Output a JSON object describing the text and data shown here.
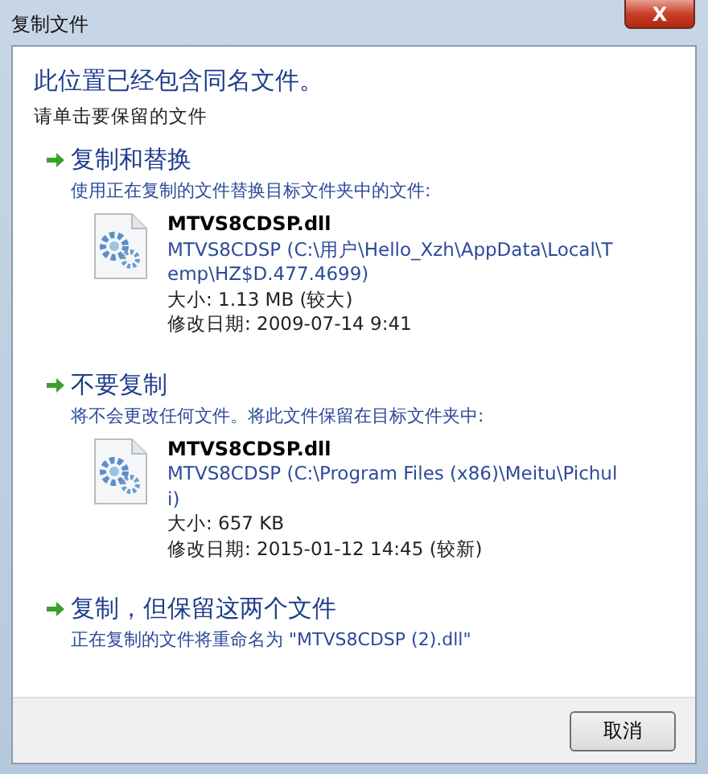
{
  "window": {
    "title": "复制文件",
    "close_label": "X"
  },
  "heading": "此位置已经包含同名文件。",
  "instruction": "请单击要保留的文件",
  "options": [
    {
      "title": "复制和替换",
      "description": "使用正在复制的文件替换目标文件夹中的文件:",
      "file": {
        "name": "MTVS8CDSP.dll",
        "location": "MTVS8CDSP (C:\\用户\\Hello_Xzh\\AppData\\Local\\Temp\\HZ$D.477.4699)",
        "size": "大小: 1.13 MB (较大)",
        "modified": "修改日期: 2009-07-14 9:41"
      }
    },
    {
      "title": "不要复制",
      "description": "将不会更改任何文件。将此文件保留在目标文件夹中:",
      "file": {
        "name": "MTVS8CDSP.dll",
        "location": "MTVS8CDSP (C:\\Program Files (x86)\\Meitu\\Pichuli)",
        "size": "大小: 657 KB",
        "modified": "修改日期: 2015-01-12 14:45 (较新)"
      }
    },
    {
      "title": "复制，但保留这两个文件",
      "description": "正在复制的文件将重命名为 \"MTVS8CDSP (2).dll\""
    }
  ],
  "buttons": [
    "取消"
  ]
}
